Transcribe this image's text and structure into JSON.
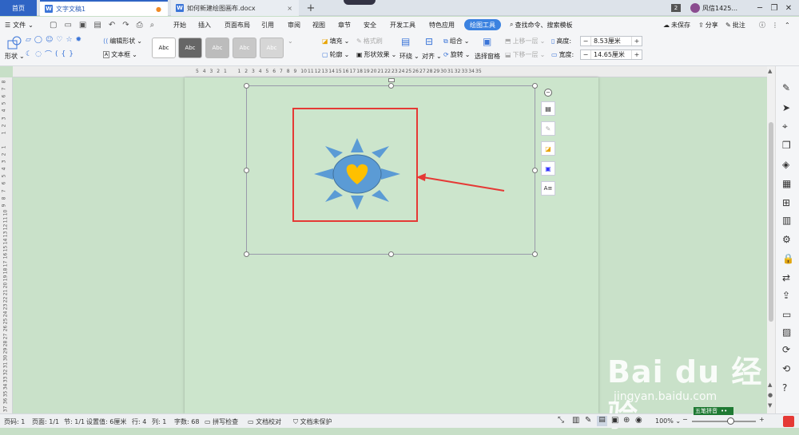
{
  "titlebar": {
    "home_tab": "首页",
    "doc_tab_active": "文字文稿1",
    "doc_tab_2": "如何新建绘图画布.docx",
    "new_tab": "+",
    "badge": "2",
    "user_name": "风信1425..."
  },
  "menubar": {
    "file": "文件",
    "items": [
      "开始",
      "插入",
      "页面布局",
      "引用",
      "审阅",
      "视图",
      "章节",
      "安全",
      "开发工具",
      "特色应用",
      "绘图工具"
    ],
    "search": "查找命令、搜索模板",
    "unsaved": "未保存",
    "share": "分享",
    "comment": "批注"
  },
  "ribbon": {
    "shape_label": "形状",
    "edit_shape": "编辑形状",
    "text_box": "文本框",
    "style_samples": [
      "Abc",
      "Abc",
      "Abc",
      "Abc",
      "Abc"
    ],
    "fill": "填充",
    "format_brush": "格式刷",
    "outline": "轮廓",
    "shape_effect": "形状效果",
    "wrap": "环绕",
    "align": "对齐",
    "group": "组合",
    "rotate": "旋转",
    "selection_pane": "选择窗格",
    "bring_forward": "上移一层",
    "send_backward": "下移一层",
    "height_label": "高度:",
    "height_value": "8.53厘米",
    "width_label": "宽度:",
    "width_value": "14.65厘米"
  },
  "ruler": {
    "top_ticks": [
      "5",
      "4",
      "3",
      "2",
      "1",
      "",
      "1",
      "2",
      "3",
      "4",
      "5",
      "6",
      "7",
      "8",
      "9",
      "10",
      "11",
      "12",
      "13",
      "14",
      "15",
      "16",
      "17",
      "18",
      "19",
      "20",
      "21",
      "22",
      "23",
      "24",
      "25",
      "26",
      "27",
      "28",
      "29",
      "30",
      "31",
      "32",
      "33",
      "34",
      "35"
    ],
    "left_ticks": [
      "8",
      "7",
      "6",
      "5",
      "4",
      "3",
      "2",
      "1",
      "",
      "1",
      "2",
      "3",
      "4",
      "5",
      "6",
      "7",
      "8",
      "9",
      "10",
      "11",
      "12",
      "13",
      "14",
      "15",
      "16",
      "17",
      "18",
      "19",
      "20",
      "21",
      "22",
      "23",
      "24",
      "25",
      "26",
      "27",
      "28",
      "29",
      "30",
      "31",
      "32",
      "33",
      "34",
      "35",
      "36",
      "37",
      "38",
      "39",
      "40",
      "41",
      "42",
      "43",
      "44",
      "45",
      "46",
      "47"
    ]
  },
  "statusbar": {
    "page_num": "页码: 1",
    "page": "页面: 1/1",
    "section": "节: 1/1",
    "setting": "设置值: 6厘米",
    "row": "行: 4",
    "col": "列: 1",
    "words": "字数: 68",
    "spell": "拼写检查",
    "proof": "文档校对",
    "protect": "文档未保护",
    "zoom": "100%",
    "zoom_level": 0.6,
    "ime": "五笔拼音"
  },
  "watermark": {
    "logo": "Bai du 经验",
    "url": "jingyan.baidu.com"
  },
  "colors": {
    "accent": "#3b82e0",
    "sun_ray": "#5b9bd5",
    "heart": "#ffc000",
    "highlight": "#e53935"
  }
}
